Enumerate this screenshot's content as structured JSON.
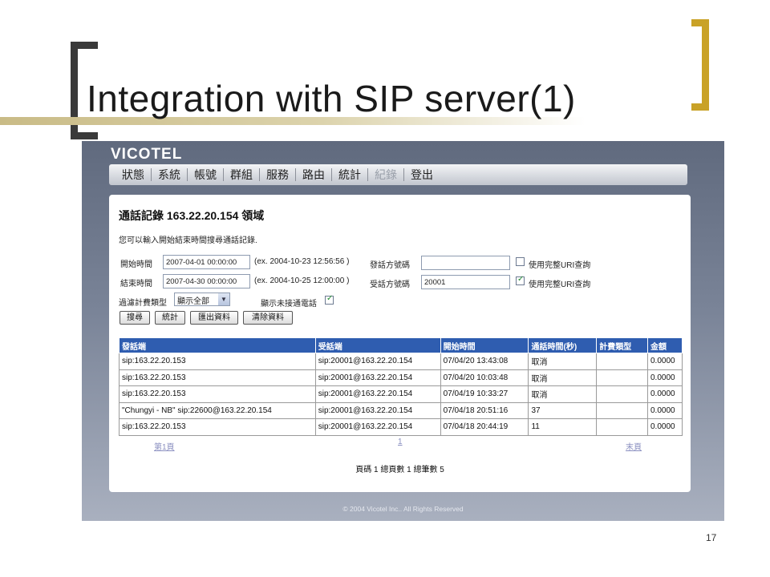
{
  "slide": {
    "title": "Integration with SIP server(1)",
    "page_number": "17"
  },
  "app": {
    "logo": "VICOTEL",
    "nav": [
      "狀態",
      "系統",
      "帳號",
      "群組",
      "服務",
      "路由",
      "統計",
      "紀錄",
      "登出"
    ],
    "active_nav_index": 7,
    "panel_title": "通話記錄 163.22.20.154 領域",
    "panel_desc": "您可以輸入開始結束時間搜尋通話記錄.",
    "form": {
      "start_time_label": "開始時間",
      "start_time_value": "2007-04-01 00:00:00",
      "start_time_hint": "(ex. 2004-10-23 12:56:56 )",
      "end_time_label": "結束時間",
      "end_time_value": "2007-04-30 00:00:00",
      "end_time_hint": "(ex. 2004-10-25 12:00:00 )",
      "caller_label": "發話方號碼",
      "caller_value": "",
      "callee_label": "受話方號碼",
      "callee_value": "20001",
      "full_uri_label": "使用完整URI查詢",
      "full_uri_caller_checked": false,
      "full_uri_callee_checked": true,
      "billing_filter_label": "過濾計費類型",
      "billing_filter_value": "顯示全部",
      "show_unanswered_label": "顯示未接通電話",
      "show_unanswered_checked": true
    },
    "buttons": {
      "search": "搜尋",
      "stats": "統計",
      "export": "匯出資料",
      "clear": "清除資料"
    },
    "table": {
      "columns": [
        "發話端",
        "受話端",
        "開始時間",
        "通話時間(秒)",
        "計費類型",
        "金額"
      ],
      "rows": [
        [
          "sip:163.22.20.153",
          "sip:20001@163.22.20.154",
          "07/04/20 13:43:08",
          "取消",
          "",
          "0.0000"
        ],
        [
          "sip:163.22.20.153",
          "sip:20001@163.22.20.154",
          "07/04/20 10:03:48",
          "取消",
          "",
          "0.0000"
        ],
        [
          "sip:163.22.20.153",
          "sip:20001@163.22.20.154",
          "07/04/19 10:33:27",
          "取消",
          "",
          "0.0000"
        ],
        [
          "\"Chungyi - NB\" sip:22600@163.22.20.154",
          "sip:20001@163.22.20.154",
          "07/04/18 20:51:16",
          "37",
          "",
          "0.0000"
        ],
        [
          "sip:163.22.20.153",
          "sip:20001@163.22.20.154",
          "07/04/18 20:44:19",
          "11",
          "",
          "0.0000"
        ]
      ]
    },
    "pager": {
      "first": "第1頁",
      "current": "1",
      "last": "末頁",
      "summary": "頁碼 1 總頁數 1 總筆數 5"
    },
    "copyright": "© 2004 Vicotel Inc.. All Rights Reserved"
  },
  "colors": {
    "accent_gold": "#c9a227",
    "table_header": "#2f5db0",
    "app_background": "#6f7a8f"
  }
}
